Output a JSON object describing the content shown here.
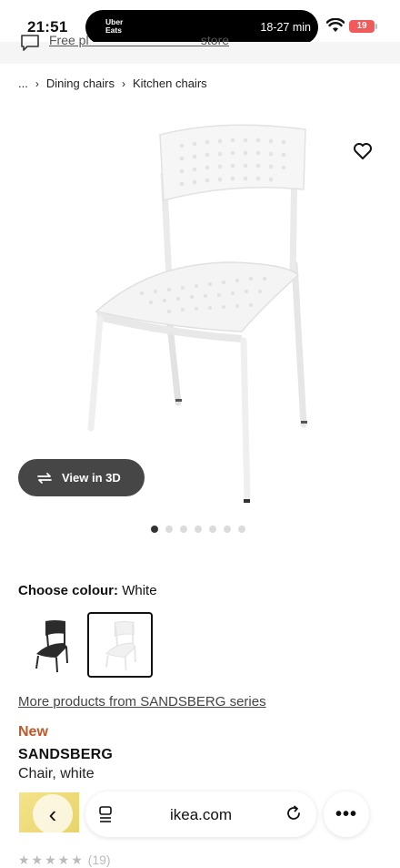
{
  "status_bar": {
    "time": "21:51",
    "island_logo_line1": "Uber",
    "island_logo_line2": "Eats",
    "eta": "18-27 min",
    "battery": "19",
    "battery_color": "#f05a5a"
  },
  "banner": {
    "text": "Free pl                                            store",
    "icon": "chat-icon"
  },
  "breadcrumb": {
    "ellipsis": "...",
    "items": [
      "Dining chairs",
      "Kitchen chairs"
    ]
  },
  "product": {
    "view_3d_label": "View in 3D",
    "image_count": 7,
    "active_image": 1,
    "colour_label": "Choose colour:",
    "colour_value": "White",
    "series_link": "More products from SANDSBERG series",
    "badge": "New",
    "badge_color": "#c0582a",
    "name": "SANDSBERG",
    "description": "Chair, white",
    "rating_count": "(19)"
  },
  "browser": {
    "url": "ikea.com",
    "more": "•••"
  }
}
